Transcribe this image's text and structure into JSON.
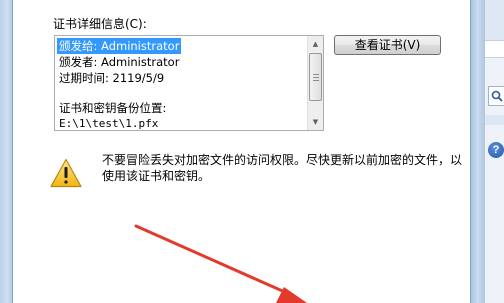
{
  "dialog": {
    "field_label": "证书详细信息(C):",
    "details": {
      "issued_to": "颁发给: Administrator",
      "issued_by": "颁发者: Administrator",
      "expiry": "过期时间: 2119/5/9",
      "backup_location_label": "证书和密钥备份位置:",
      "backup_path": "E:\\1\\test\\1.pfx"
    },
    "view_certificate_button": "查看证书(V)",
    "warning_text": "不要冒险丢失对加密文件的访问权限。尽快更新以前加密的文件，以使用该证书和密钥。"
  },
  "icons": {
    "warning": "warning-icon",
    "search": "search-icon",
    "help": "help-icon",
    "arrow": "red-annotation-arrow"
  },
  "colors": {
    "selection": "#3399ff",
    "annotation": "#e23b2e",
    "warning_fill": "#f7c62f"
  }
}
